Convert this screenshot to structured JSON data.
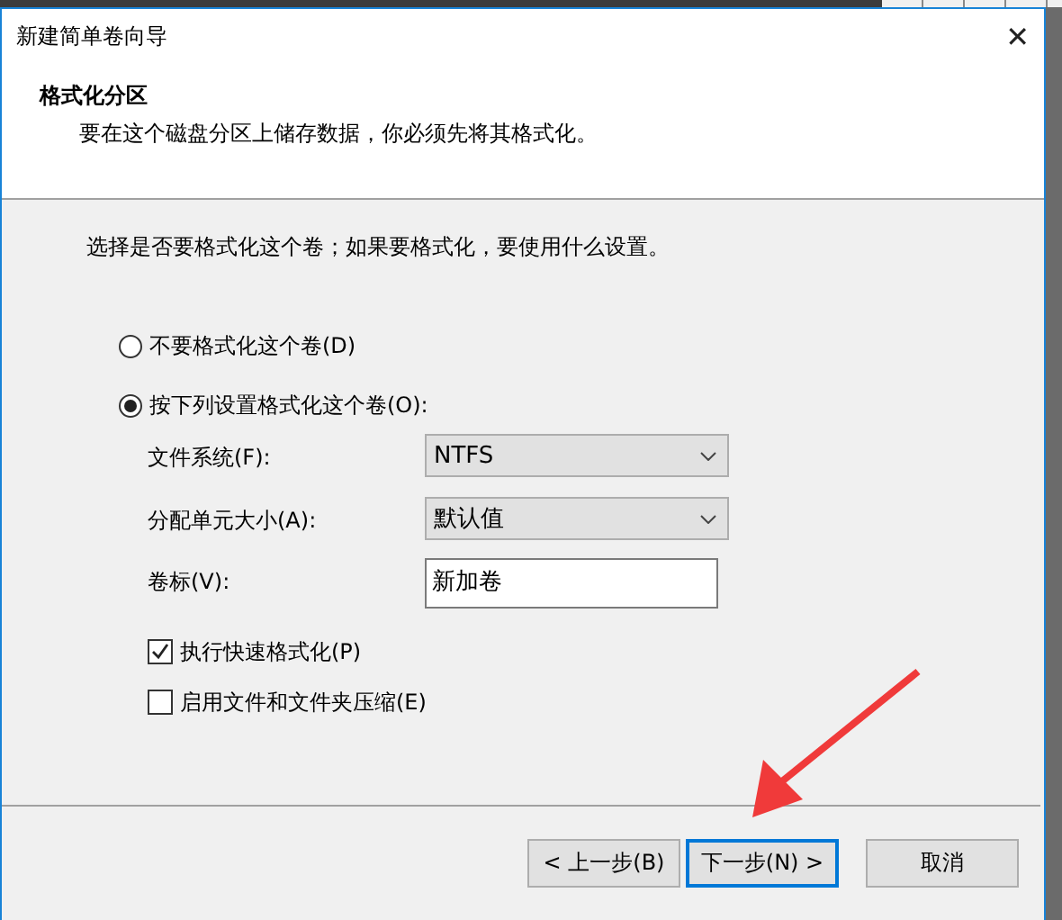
{
  "window": {
    "title": "新建简单卷向导",
    "close": "✕"
  },
  "header": {
    "title": "格式化分区",
    "subtitle": "要在这个磁盘分区上储存数据，你必须先将其格式化。"
  },
  "prompt": "选择是否要格式化这个卷；如果要格式化，要使用什么设置。",
  "options": [
    {
      "label": "不要格式化这个卷(D)",
      "selected": false
    },
    {
      "label": "按下列设置格式化这个卷(O):",
      "selected": true
    }
  ],
  "fields": [
    {
      "kind": "dropdown",
      "label": "文件系统(F):",
      "value": "NTFS"
    },
    {
      "kind": "dropdown",
      "label": "分配单元大小(A):",
      "value": "默认值"
    },
    {
      "kind": "text",
      "label": "卷标(V):",
      "value": "新加卷"
    }
  ],
  "checkboxes": [
    {
      "label": "执行快速格式化(P)",
      "checked": true
    },
    {
      "label": "启用文件和文件夹压缩(E)",
      "checked": false
    }
  ],
  "buttons": [
    {
      "label": "< 上一步(B)",
      "focused": false
    },
    {
      "label": "下一步(N) >",
      "focused": true
    },
    {
      "label": "取消",
      "focused": false
    }
  ]
}
